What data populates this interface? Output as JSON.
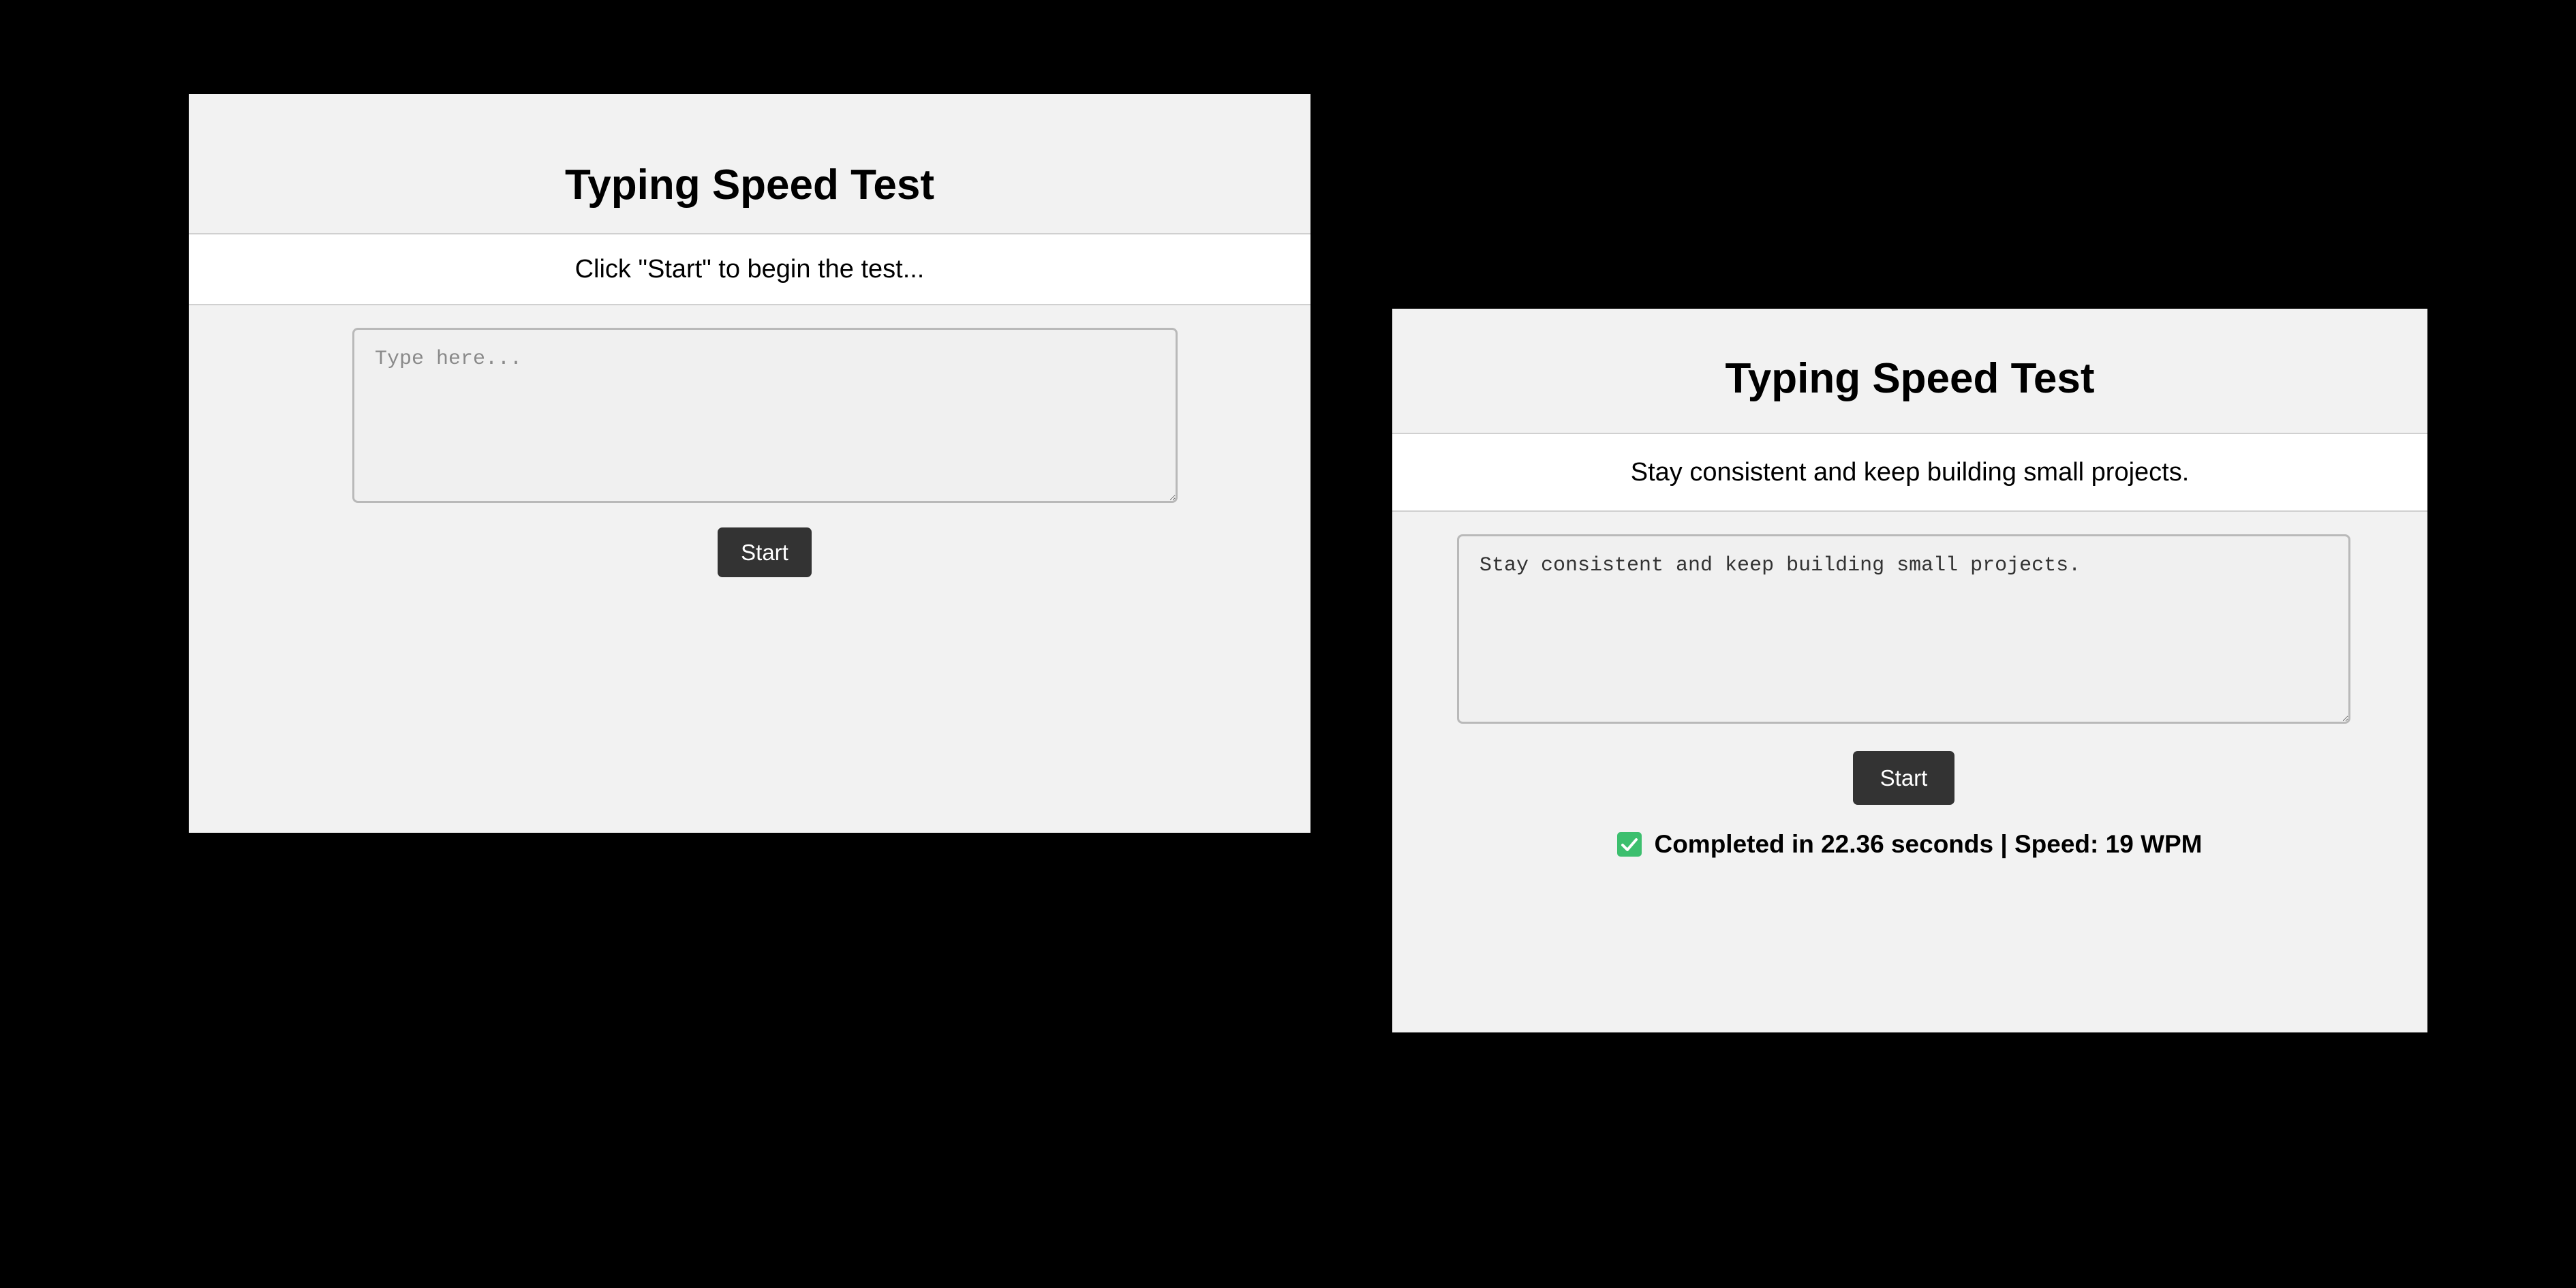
{
  "left_panel": {
    "title": "Typing Speed Test",
    "prompt_text": "Click \"Start\" to begin the test...",
    "input": {
      "value": "",
      "placeholder": "Type here..."
    },
    "start_label": "Start"
  },
  "right_panel": {
    "title": "Typing Speed Test",
    "prompt_text": "Stay consistent and keep building small projects.",
    "input": {
      "value": "Stay consistent and keep building small projects.",
      "placeholder": "Type here..."
    },
    "start_label": "Start",
    "result": {
      "icon": "check-mark-icon",
      "text": "Completed in 22.36 seconds | Speed: 19 WPM"
    }
  },
  "colors": {
    "page_background": "#000000",
    "panel_background": "#f2f2f2",
    "quote_background": "#ffffff",
    "button_background": "#333333",
    "success": "#3cbf6e"
  }
}
